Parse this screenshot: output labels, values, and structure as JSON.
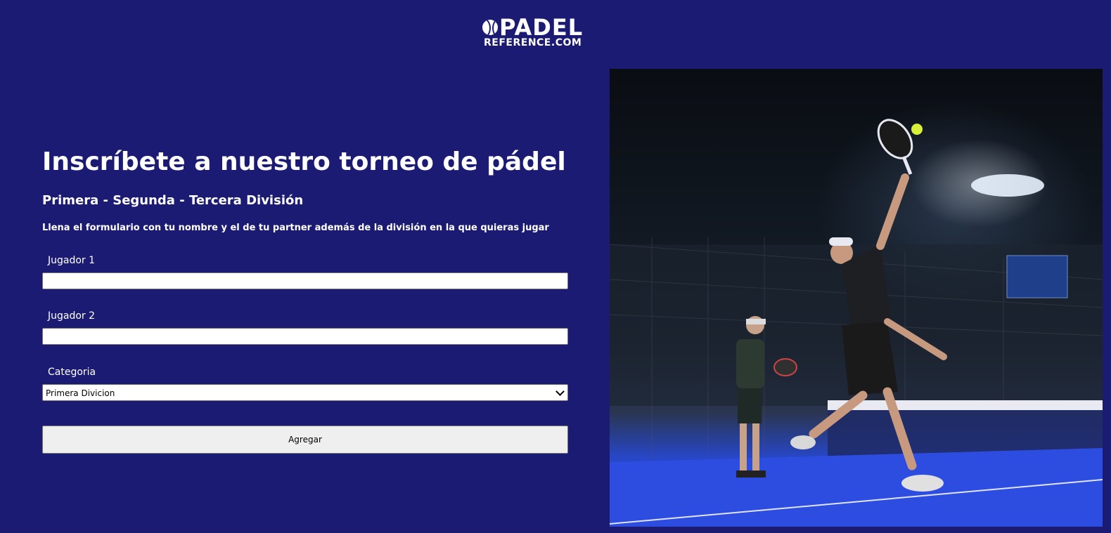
{
  "brand": {
    "name": "PADEL",
    "domain": "REFERENCE.COM"
  },
  "form": {
    "title": "Inscríbete a nuestro torneo de pádel",
    "subtitle": "Primera - Segunda - Tercera División",
    "description": "Llena el formulario con tu nombre y el de tu partner además de la división en la que quieras jugar",
    "player1_label": "Jugador 1",
    "player1_value": "",
    "player2_label": "Jugador 2",
    "player2_value": "",
    "category_label": "Categoria",
    "category_selected": "Primera Divicion",
    "submit_label": "Agregar"
  },
  "colors": {
    "background": "#1b1b73",
    "court": "#2a4ad6",
    "button": "#efefef"
  }
}
